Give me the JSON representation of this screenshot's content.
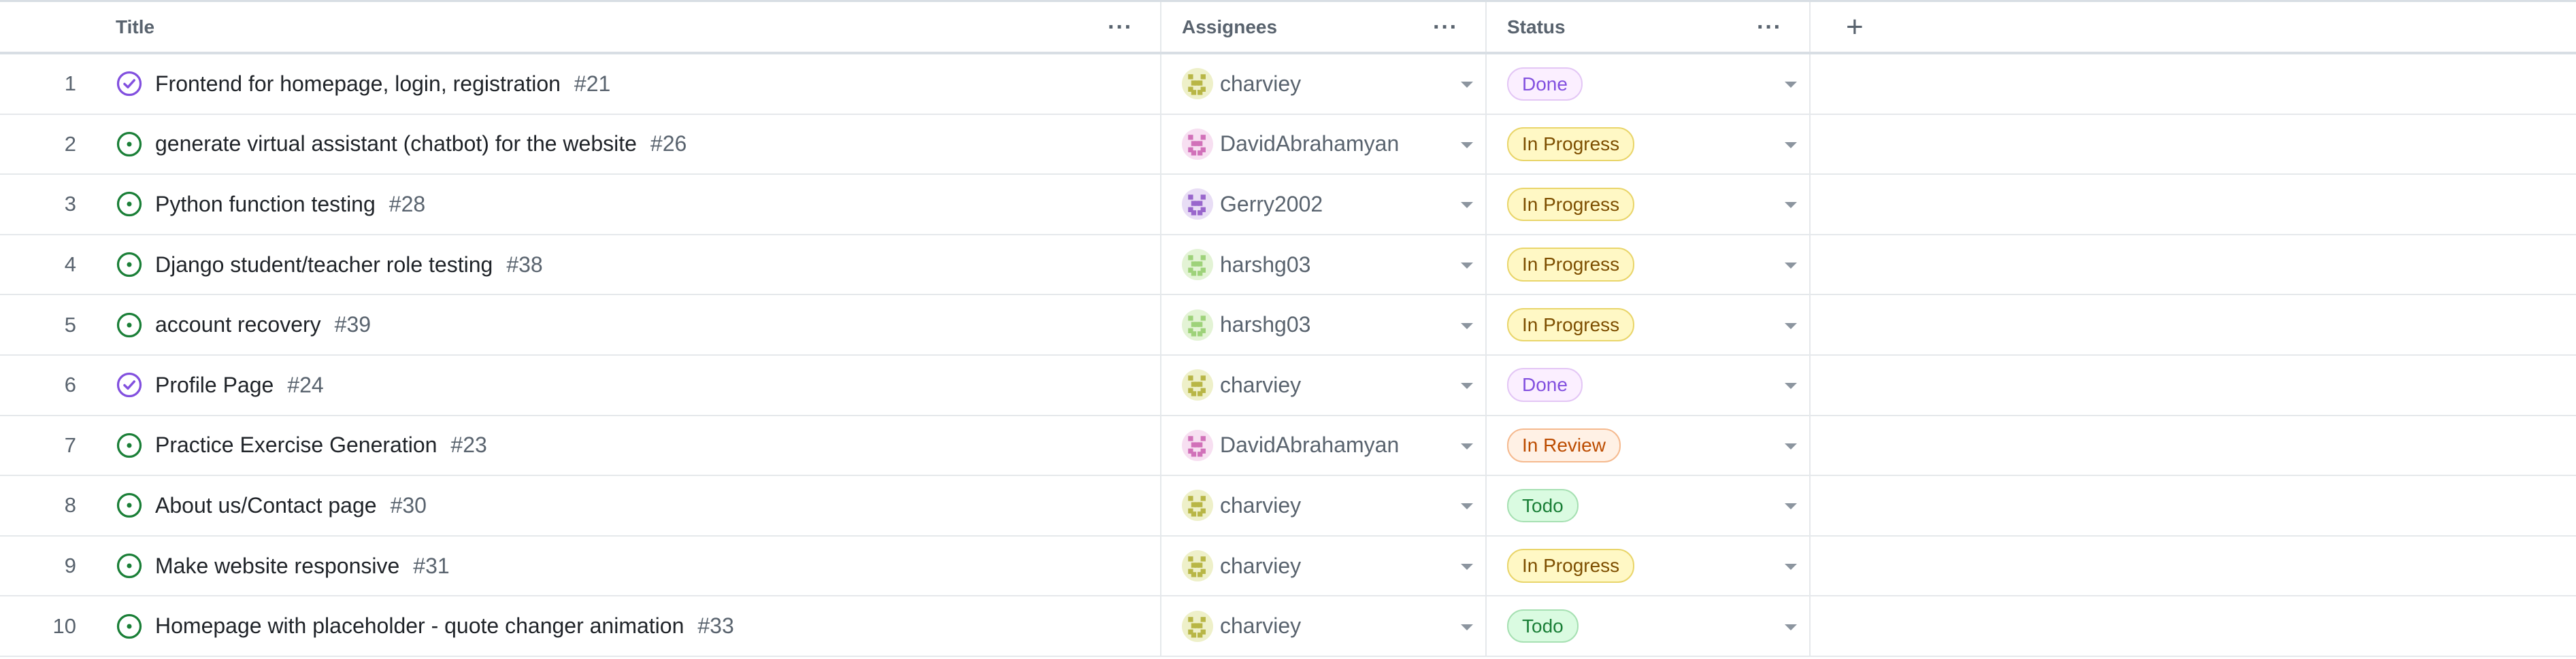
{
  "header": {
    "title_label": "Title",
    "assignees_label": "Assignees",
    "status_label": "Status",
    "menu_glyph": "···",
    "add_glyph": "+"
  },
  "status_styles": {
    "Done": {
      "bg": "#fbefff",
      "border": "#e3c6f5",
      "color": "#8250df"
    },
    "In Progress": {
      "bg": "#fff8c5",
      "border": "#e9d56a",
      "color": "#7d4e00"
    },
    "In Review": {
      "bg": "#fff1e5",
      "border": "#f5b98e",
      "color": "#bc4c00"
    },
    "Todo": {
      "bg": "#dafbe1",
      "border": "#a6e0b2",
      "color": "#1a7f37"
    }
  },
  "avatar_colors": {
    "charviey": {
      "bg": "#eef0c9",
      "fg": "#b8b646"
    },
    "DavidAbrahamyan": {
      "bg": "#f7dff1",
      "fg": "#d171b9"
    },
    "Gerry2002": {
      "bg": "#e8ddf5",
      "fg": "#9966cc"
    },
    "harshg03": {
      "bg": "#e3f3d5",
      "fg": "#9ed27a"
    }
  },
  "rows": [
    {
      "num": "1",
      "state": "closed",
      "title": "Frontend for homepage, login, registration",
      "issue": "#21",
      "assignee": "charviey",
      "status": "Done"
    },
    {
      "num": "2",
      "state": "open",
      "title": "generate virtual assistant (chatbot) for the website",
      "issue": "#26",
      "assignee": "DavidAbrahamyan",
      "status": "In Progress"
    },
    {
      "num": "3",
      "state": "open",
      "title": "Python function testing",
      "issue": "#28",
      "assignee": "Gerry2002",
      "status": "In Progress"
    },
    {
      "num": "4",
      "state": "open",
      "title": "Django student/teacher role testing",
      "issue": "#38",
      "assignee": "harshg03",
      "status": "In Progress"
    },
    {
      "num": "5",
      "state": "open",
      "title": "account recovery",
      "issue": "#39",
      "assignee": "harshg03",
      "status": "In Progress"
    },
    {
      "num": "6",
      "state": "closed",
      "title": "Profile Page",
      "issue": "#24",
      "assignee": "charviey",
      "status": "Done"
    },
    {
      "num": "7",
      "state": "open",
      "title": "Practice Exercise Generation",
      "issue": "#23",
      "assignee": "DavidAbrahamyan",
      "status": "In Review"
    },
    {
      "num": "8",
      "state": "open",
      "title": "About us/Contact page",
      "issue": "#30",
      "assignee": "charviey",
      "status": "Todo"
    },
    {
      "num": "9",
      "state": "open",
      "title": "Make website responsive",
      "issue": "#31",
      "assignee": "charviey",
      "status": "In Progress"
    },
    {
      "num": "10",
      "state": "open",
      "title": "Homepage with placeholder - quote changer animation",
      "issue": "#33",
      "assignee": "charviey",
      "status": "Todo"
    }
  ]
}
